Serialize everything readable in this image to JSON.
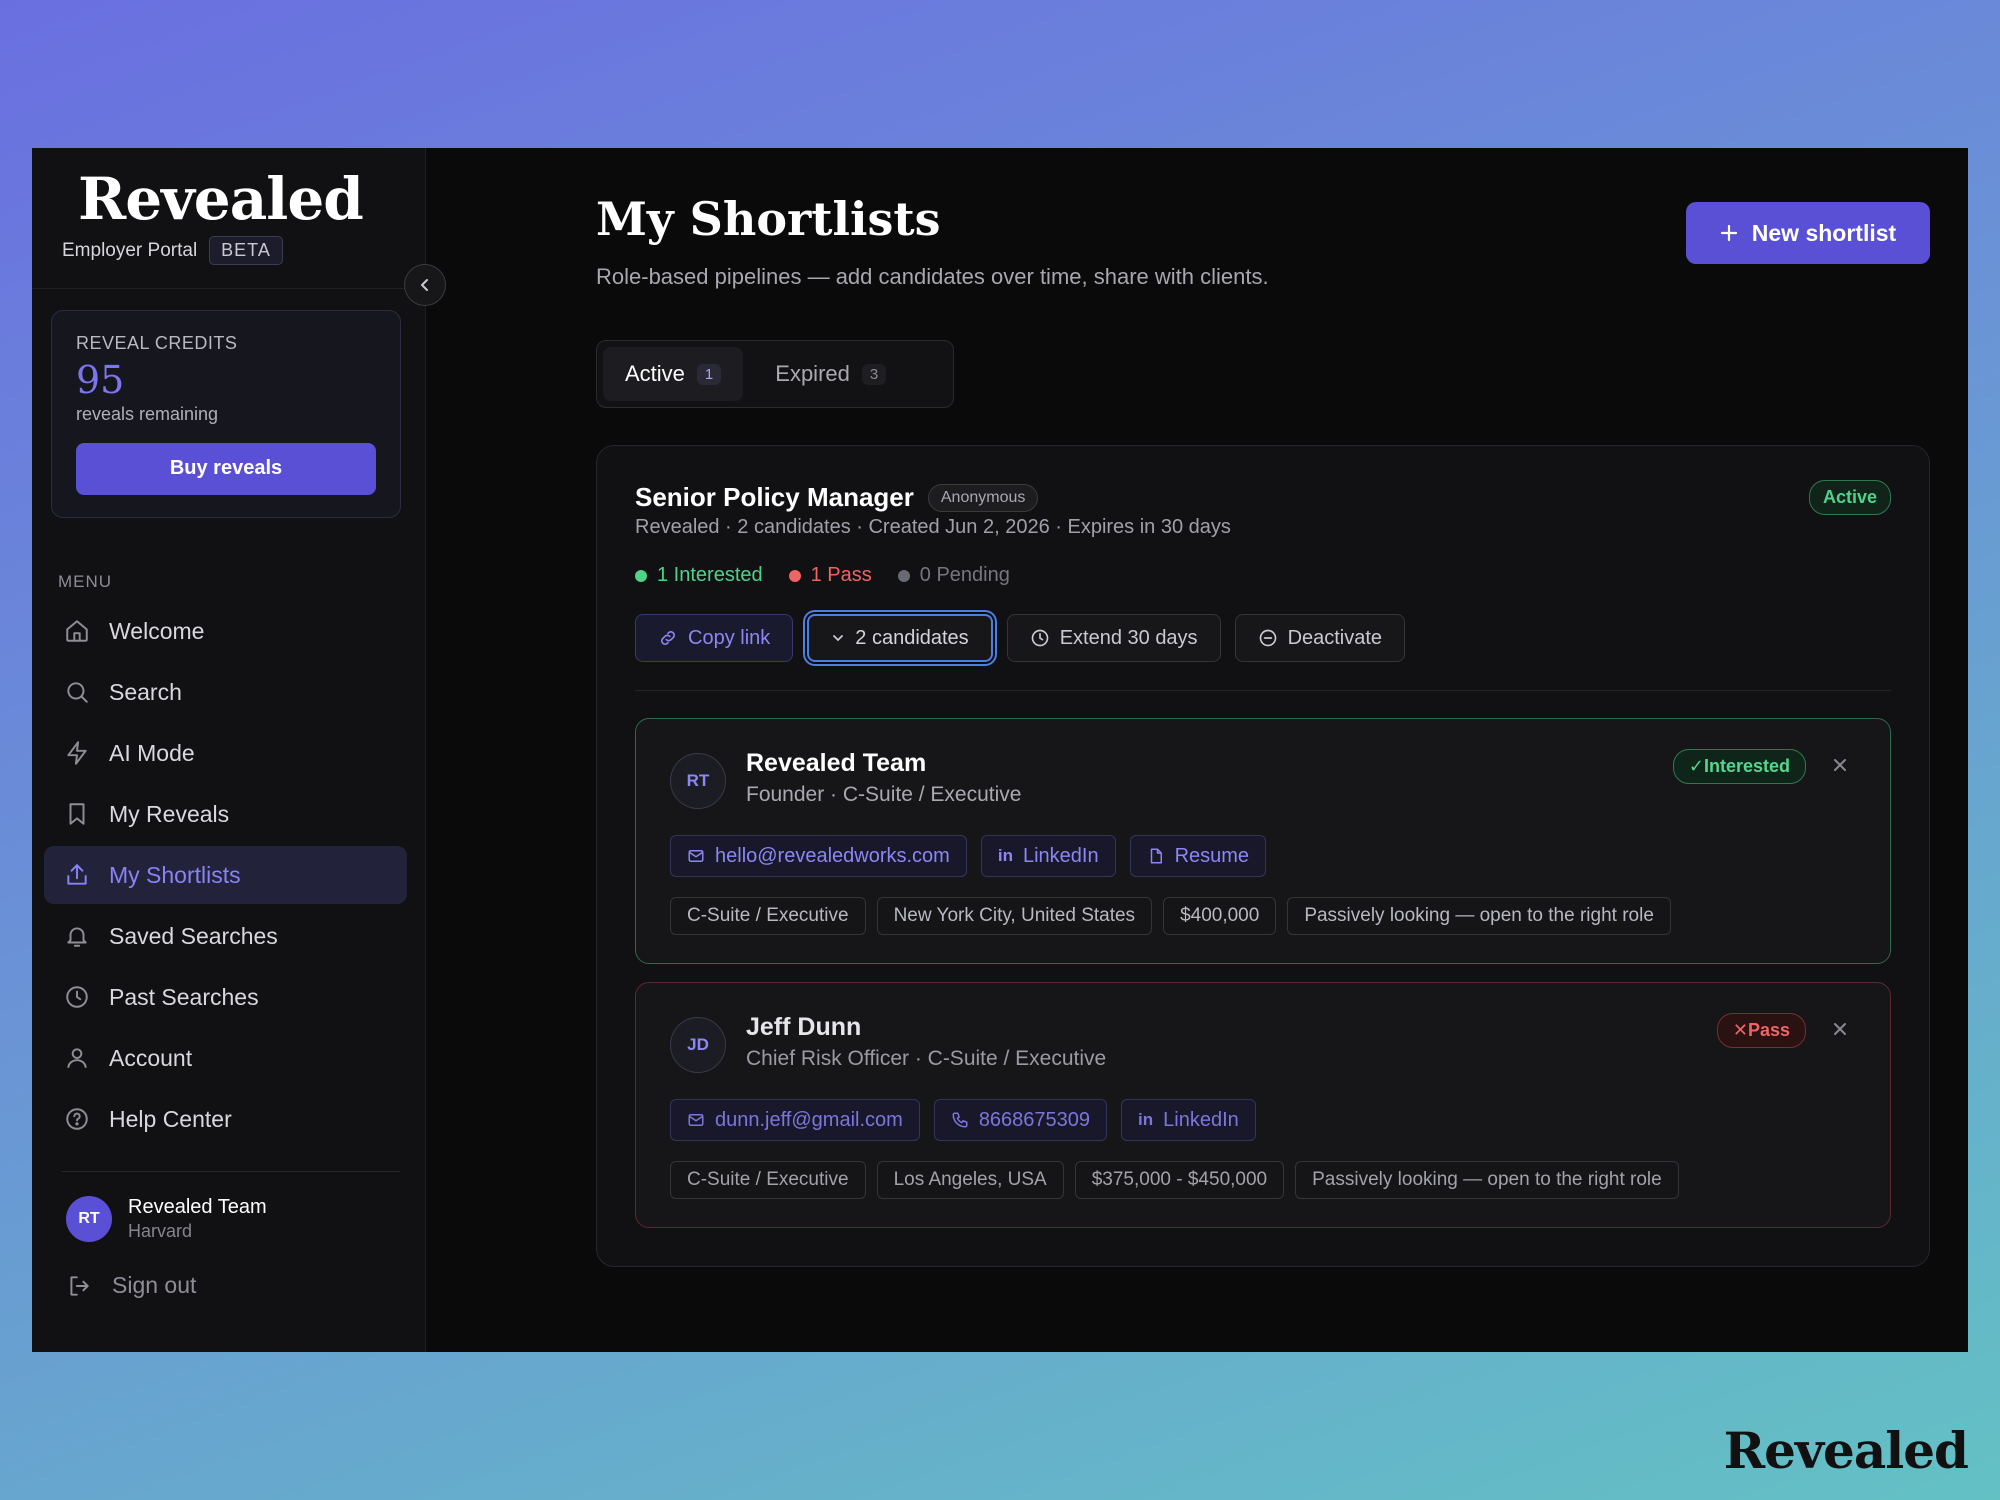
{
  "brand": {
    "name": "Revealed",
    "portal": "Employer Portal",
    "beta": "BETA"
  },
  "credits": {
    "label": "REVEAL CREDITS",
    "count": "95",
    "sub": "reveals remaining",
    "buy_label": "Buy reveals"
  },
  "menu": {
    "label": "MENU",
    "items": [
      {
        "label": "Welcome",
        "icon": "home-icon"
      },
      {
        "label": "Search",
        "icon": "search-icon"
      },
      {
        "label": "AI Mode",
        "icon": "lightning-icon"
      },
      {
        "label": "My Reveals",
        "icon": "bookmark-icon"
      },
      {
        "label": "My Shortlists",
        "icon": "share-icon",
        "active": true
      },
      {
        "label": "Saved Searches",
        "icon": "bell-icon"
      },
      {
        "label": "Past Searches",
        "icon": "clock-icon"
      },
      {
        "label": "Account",
        "icon": "user-icon"
      },
      {
        "label": "Help Center",
        "icon": "help-icon"
      }
    ]
  },
  "user": {
    "initials": "RT",
    "name": "Revealed Team",
    "org": "Harvard"
  },
  "signout_label": "Sign out",
  "header": {
    "title": "My Shortlists",
    "subtitle": "Role-based pipelines — add candidates over time, share with clients.",
    "new_button": "New shortlist"
  },
  "tabs": [
    {
      "label": "Active",
      "count": "1",
      "active": true
    },
    {
      "label": "Expired",
      "count": "3"
    }
  ],
  "shortlist": {
    "title": "Senior Policy Manager",
    "badge": "Anonymous",
    "meta": "Revealed · 2 candidates · Created Jun 2, 2026 · Expires in 30 days",
    "status": "Active",
    "stats": {
      "interested": "1 Interested",
      "pass": "1 Pass",
      "pending": "0 Pending"
    },
    "actions": {
      "copy": "Copy link",
      "candidates": "2 candidates",
      "extend": "Extend 30 days",
      "deactivate": "Deactivate"
    },
    "colors": {
      "interested": "#4fd38a",
      "pass": "#ef6464",
      "pending": "#6a6a72",
      "accent": "#5a50d6"
    }
  },
  "candidates": [
    {
      "initials": "RT",
      "name": "Revealed Team",
      "title": "Founder · C-Suite / Executive",
      "verdict": "✓Interested",
      "email": "hello@revealedworks.com",
      "linkedin": "LinkedIn",
      "resume": "Resume",
      "tags": [
        "C-Suite / Executive",
        "New York City, United States",
        "$400,000",
        "Passively looking — open to the right role"
      ]
    },
    {
      "initials": "JD",
      "name": "Jeff Dunn",
      "title": "Chief Risk Officer · C-Suite / Executive",
      "verdict": "✕Pass",
      "email": "dunn.jeff@gmail.com",
      "phone": "8668675309",
      "linkedin": "LinkedIn",
      "tags": [
        "C-Suite / Executive",
        "Los Angeles, USA",
        "$375,000 - $450,000",
        "Passively looking — open to the right role"
      ]
    }
  ],
  "footer_brand": "Revealed"
}
